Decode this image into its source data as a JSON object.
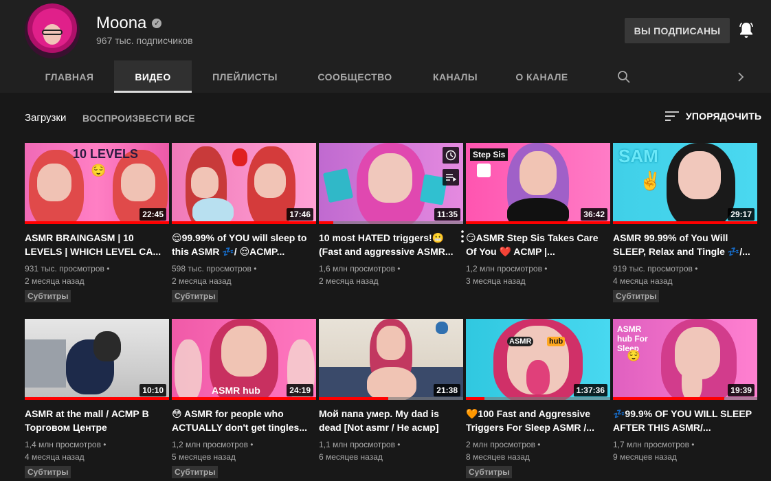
{
  "channel": {
    "name": "Moona",
    "subscribers": "967 тыс. подписчиков",
    "subscribe_label": "ВЫ ПОДПИСАНЫ"
  },
  "tabs": [
    {
      "label": "ГЛАВНАЯ",
      "active": false
    },
    {
      "label": "ВИДЕО",
      "active": true
    },
    {
      "label": "ПЛЕЙЛИСТЫ",
      "active": false
    },
    {
      "label": "СООБЩЕСТВО",
      "active": false
    },
    {
      "label": "КАНАЛЫ",
      "active": false
    },
    {
      "label": "О КАНАЛЕ",
      "active": false
    }
  ],
  "toolbar": {
    "section_title": "Загрузки",
    "play_all": "ВОСПРОИЗВЕСТИ ВСЕ",
    "sort_label": "УПОРЯДОЧИТЬ"
  },
  "videos": [
    {
      "title": "ASMR BRAINGASM | 10 LEVELS | WHICH LEVEL CA...",
      "views": "931 тыс. просмотров",
      "age": "2 месяца назад",
      "duration": "22:45",
      "badge": "Субтитры",
      "watched": 1.0,
      "thumb_text": "10 LEVELS"
    },
    {
      "title": "😌99.99% of YOU will sleep to this ASMR 💤/ 😌ACMP...",
      "views": "598 тыс. просмотров",
      "age": "2 месяца назад",
      "duration": "17:46",
      "badge": "Субтитры",
      "watched": 1.0,
      "thumb_text": ""
    },
    {
      "title": "10 most HATED triggers!😬 (Fast and aggressive ASMR...",
      "views": "1,6 млн просмотров",
      "age": "2 месяца назад",
      "duration": "11:35",
      "badge": "",
      "watched": 0.1,
      "thumb_text": ""
    },
    {
      "title": "😏ASMR Step Sis Takes Care Of You ❤️ ACMP |...",
      "views": "1,2 млн просмотров",
      "age": "3 месяца назад",
      "duration": "36:42",
      "badge": "",
      "watched": 1.0,
      "thumb_text": "Step Sis"
    },
    {
      "title": "ASMR 99.99% of You Will SLEEP, Relax and Tingle 💤/...",
      "views": "919 тыс. просмотров",
      "age": "4 месяца назад",
      "duration": "29:17",
      "badge": "Субтитры",
      "watched": 1.0,
      "thumb_text": "SAM"
    },
    {
      "title": "ASMR at the mall / АСМР В Торговом Центре",
      "views": "1,4 млн просмотров",
      "age": "4 месяца назад",
      "duration": "10:10",
      "badge": "Субтитры",
      "watched": 1.0,
      "thumb_text": ""
    },
    {
      "title": "😳 ASMR for people who ACTUALLY don't get tingles...",
      "views": "1,2 млн просмотров",
      "age": "5 месяцев назад",
      "duration": "24:19",
      "badge": "Субтитры",
      "watched": 1.0,
      "thumb_text": "ASMR hub"
    },
    {
      "title": "Мой папа умер. My dad is dead [Not asmr / Не асмр]",
      "views": "1,1 млн просмотров",
      "age": "6 месяцев назад",
      "duration": "21:38",
      "badge": "",
      "watched": 0.48,
      "thumb_text": ""
    },
    {
      "title": "🧡100 Fast and Aggressive Triggers For Sleep ASMR /...",
      "views": "2 млн просмотров",
      "age": "8 месяцев назад",
      "duration": "1:37:36",
      "badge": "Субтитры",
      "watched": 0.13,
      "thumb_text": "ASMR hub"
    },
    {
      "title": "💤99.9% OF YOU WILL SLEEP AFTER THIS ASMR/...",
      "views": "1,7 млн просмотров",
      "age": "9 месяцев назад",
      "duration": "19:39",
      "badge": "",
      "watched": 0.77,
      "thumb_text": "ASMR hub For Sleep"
    }
  ],
  "colors": {
    "accent": "#ff0000",
    "background": "#181818",
    "header": "#202020"
  }
}
